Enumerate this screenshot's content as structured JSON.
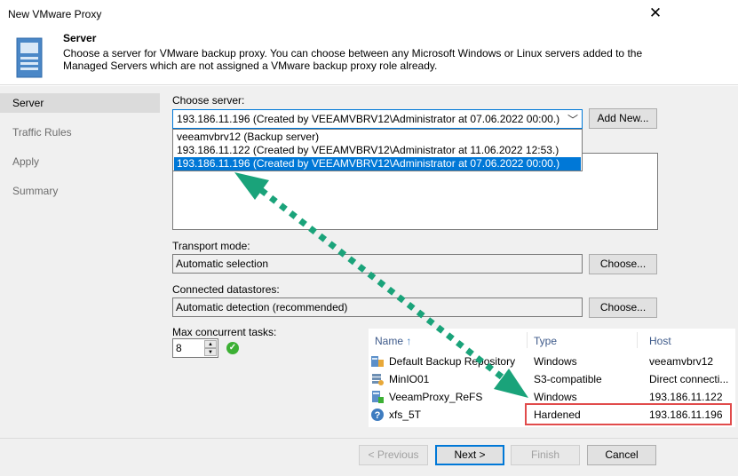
{
  "window": {
    "title": "New VMware Proxy",
    "close_glyph": "✕"
  },
  "header": {
    "title": "Server",
    "description": "Choose a server for VMware backup proxy. You can choose between any Microsoft Windows or Linux servers added to the Managed Servers which are not assigned a VMware backup proxy role already."
  },
  "sidebar": {
    "items": [
      {
        "label": "Server",
        "active": true
      },
      {
        "label": "Traffic Rules"
      },
      {
        "label": "Apply"
      },
      {
        "label": "Summary"
      }
    ]
  },
  "form": {
    "choose_server_label": "Choose server:",
    "selected_server": "193.186.11.196 (Created by VEEAMVBRV12\\Administrator at 07.06.2022 00:00.)",
    "add_new_label": "Add New...",
    "dropdown_options": [
      "veeamvbrv12 (Backup server)",
      "193.186.11.122 (Created by VEEAMVBRV12\\Administrator at 11.06.2022 12:53.)",
      "193.186.11.196 (Created by VEEAMVBRV12\\Administrator at 07.06.2022 00:00.)"
    ],
    "transport_mode_label": "Transport mode:",
    "transport_mode_value": "Automatic selection",
    "transport_choose_label": "Choose...",
    "datastores_label": "Connected datastores:",
    "datastores_value": "Automatic detection (recommended)",
    "datastores_choose_label": "Choose...",
    "max_tasks_label": "Max concurrent tasks:",
    "max_tasks_value": "8"
  },
  "repo_table": {
    "headers": {
      "name": "Name",
      "type": "Type",
      "host": "Host",
      "sort_glyph": "↑"
    },
    "rows": [
      {
        "name": "Default Backup Repository",
        "type": "Windows",
        "host": "veeamvbrv12",
        "icon": "repository-icon"
      },
      {
        "name": "MinIO01",
        "type": "S3-compatible",
        "host": "Direct connecti...",
        "icon": "object-storage-icon"
      },
      {
        "name": "VeeamProxy_ReFS",
        "type": "Windows",
        "host": "193.186.11.122",
        "icon": "windows-repository-icon"
      },
      {
        "name": "xfs_5T",
        "type": "Hardened",
        "host": "193.186.11.196",
        "icon": "question-icon"
      }
    ]
  },
  "buttons": {
    "previous": "< Previous",
    "next": "Next >",
    "finish": "Finish",
    "cancel": "Cancel"
  },
  "colors": {
    "accent": "#0078d7",
    "highlight_box": "#e14b4b",
    "arrow": "#1aa37a"
  }
}
